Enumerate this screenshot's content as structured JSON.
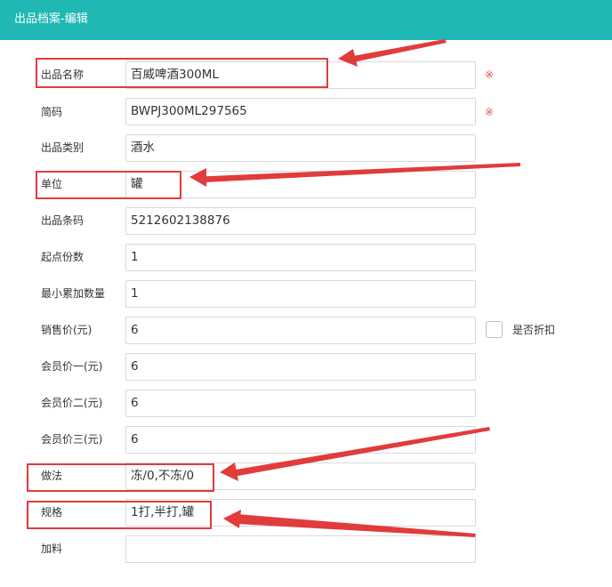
{
  "header": {
    "title": "出品档案-编辑"
  },
  "form": {
    "name": {
      "label": "出品名称",
      "value": "百威啤酒300ML",
      "required_mark": "※"
    },
    "code": {
      "label": "简码",
      "value": "BWPJ300ML297565",
      "required_mark": "※"
    },
    "category": {
      "label": "出品类别",
      "value": "酒水"
    },
    "unit": {
      "label": "单位",
      "value": "罐"
    },
    "barcode": {
      "label": "出品条码",
      "value": "5212602138876"
    },
    "min_portion": {
      "label": "起点份数",
      "value": "1"
    },
    "min_increment": {
      "label": "最小累加数量",
      "value": "1"
    },
    "price": {
      "label": "销售价(元)",
      "value": "6",
      "discount_label": "是否折扣"
    },
    "member_price1": {
      "label": "会员价一(元)",
      "value": "6"
    },
    "member_price2": {
      "label": "会员价二(元)",
      "value": "6"
    },
    "member_price3": {
      "label": "会员价三(元)",
      "value": "6"
    },
    "method": {
      "label": "做法",
      "value": "冻/0,不冻/0"
    },
    "spec": {
      "label": "规格",
      "value": "1打,半打,罐"
    },
    "addon": {
      "label": "加料",
      "value": ""
    }
  },
  "colors": {
    "header_bg": "#1fb8b4",
    "annotation_red": "#e03c3c",
    "required_mark": "#e5534b"
  }
}
